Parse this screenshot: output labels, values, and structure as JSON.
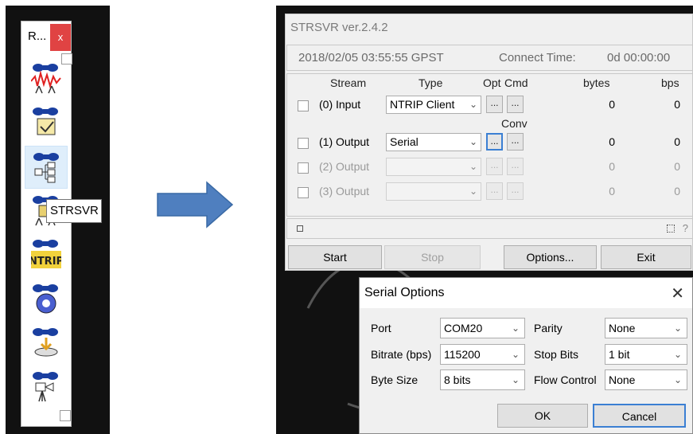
{
  "launcher": {
    "title": "R...",
    "close": "x",
    "tools": [
      "rtkplot",
      "rtkpost",
      "strsvr",
      "rtkconv",
      "ntrip",
      "rtkget",
      "netdiag",
      "rtknavi"
    ],
    "tooltip": "STRSVR"
  },
  "window": {
    "title": "STRSVR ver.2.4.2",
    "time": "2018/02/05 03:55:55 GPST",
    "connect_label": "Connect Time:",
    "connect_value": "0d 00:00:00",
    "headers": {
      "stream": "Stream",
      "type": "Type",
      "opt": "Opt",
      "cmd": "Cmd",
      "bytes": "bytes",
      "bps": "bps",
      "conv": "Conv"
    },
    "rows": [
      {
        "label": "(0) Input",
        "type": "NTRIP Client",
        "bytes": "0",
        "bps": "0"
      },
      {
        "label": "(1) Output",
        "type": "Serial",
        "bytes": "0",
        "bps": "0"
      },
      {
        "label": "(2) Output",
        "type": "",
        "bytes": "0",
        "bps": "0"
      },
      {
        "label": "(3) Output",
        "type": "",
        "bytes": "0",
        "bps": "0"
      }
    ],
    "dots": "...",
    "help": "?",
    "buttons": {
      "start": "Start",
      "stop": "Stop",
      "options": "Options...",
      "exit": "Exit"
    }
  },
  "dialog": {
    "title": "Serial Options",
    "close": "✕",
    "port_label": "Port",
    "port": "COM20",
    "bitrate_label": "Bitrate (bps)",
    "bitrate": "115200",
    "bytesize_label": "Byte Size",
    "bytesize": "8 bits",
    "parity_label": "Parity",
    "parity": "None",
    "stopbits_label": "Stop Bits",
    "stopbits": "1 bit",
    "flow_label": "Flow Control",
    "flow": "None",
    "ok": "OK",
    "cancel": "Cancel"
  },
  "colors": {
    "focus": "#3b7fd3",
    "arrow": "#4f7fbf",
    "close": "#e04343"
  }
}
